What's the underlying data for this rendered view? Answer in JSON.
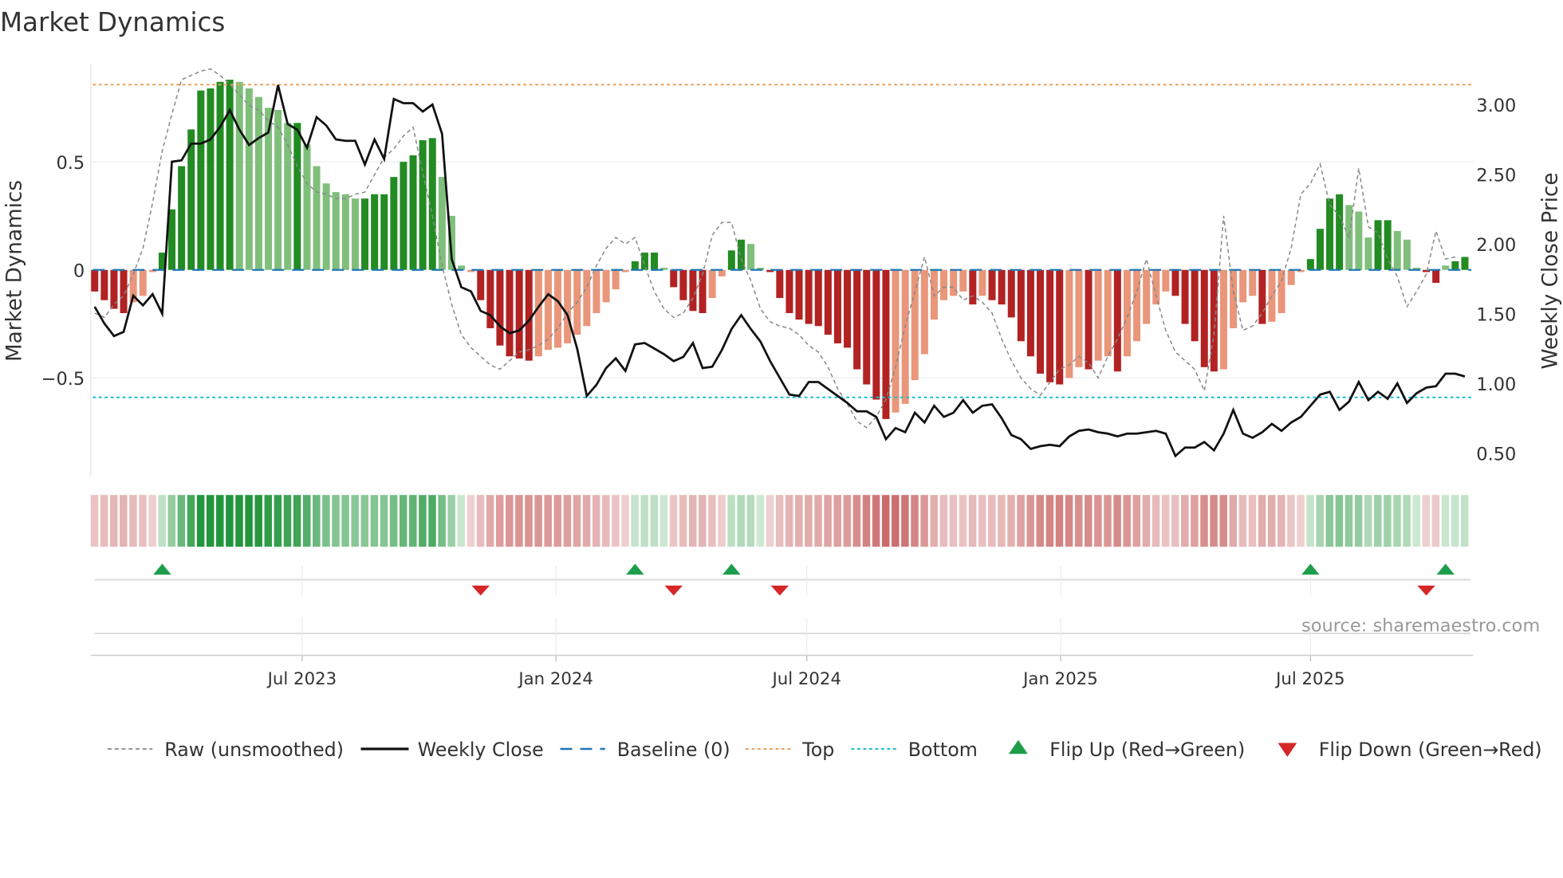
{
  "chart_data": {
    "type": "bar",
    "title": "Market Dynamics",
    "ylabel": "Market Dynamics",
    "y2label": "Weekly Close Price",
    "ylim": [
      -0.97,
      0.97
    ],
    "y2lim": [
      0.32,
      3.3
    ],
    "yticks": [
      {
        "v": 0.5,
        "label": "0.5"
      },
      {
        "v": 0,
        "label": "0"
      },
      {
        "v": -0.5,
        "label": "−0.5"
      }
    ],
    "y2ticks": [
      {
        "v": 3.0,
        "label": "3.00"
      },
      {
        "v": 2.5,
        "label": "2.50"
      },
      {
        "v": 2.0,
        "label": "2.00"
      },
      {
        "v": 1.5,
        "label": "1.50"
      },
      {
        "v": 1.0,
        "label": "1.00"
      },
      {
        "v": 0.5,
        "label": "0.50"
      }
    ],
    "xticks": [
      {
        "week": 21.5,
        "label": "Jul 2023"
      },
      {
        "week": 47.8,
        "label": "Jan 2024"
      },
      {
        "week": 73.8,
        "label": "Jul 2024"
      },
      {
        "week": 100.1,
        "label": "Jan 2025"
      },
      {
        "week": 126.0,
        "label": "Jul 2025"
      }
    ],
    "top_level": 0.857,
    "bottom_level": -0.59,
    "baseline": 0,
    "series": [
      {
        "name": "Market Dynamics (smoothed)",
        "values": [
          -0.1,
          -0.14,
          -0.18,
          -0.2,
          -0.15,
          -0.12,
          -0.01,
          0.08,
          0.28,
          0.48,
          0.65,
          0.83,
          0.84,
          0.87,
          0.88,
          0.87,
          0.84,
          0.8,
          0.75,
          0.74,
          0.68,
          0.68,
          0.58,
          0.48,
          0.4,
          0.36,
          0.35,
          0.33,
          0.33,
          0.35,
          0.35,
          0.43,
          0.5,
          0.53,
          0.6,
          0.61,
          0.43,
          0.25,
          0.02,
          -0.01,
          -0.14,
          -0.27,
          -0.35,
          -0.4,
          -0.41,
          -0.42,
          -0.4,
          -0.37,
          -0.36,
          -0.34,
          -0.3,
          -0.26,
          -0.2,
          -0.15,
          -0.09,
          -0.01,
          0.04,
          0.08,
          0.08,
          0.01,
          -0.08,
          -0.14,
          -0.19,
          -0.2,
          -0.13,
          -0.03,
          0.09,
          0.14,
          0.12,
          0.01,
          -0.01,
          -0.13,
          -0.2,
          -0.23,
          -0.25,
          -0.26,
          -0.3,
          -0.34,
          -0.36,
          -0.46,
          -0.53,
          -0.6,
          -0.69,
          -0.66,
          -0.62,
          -0.51,
          -0.39,
          -0.23,
          -0.14,
          -0.12,
          -0.1,
          -0.16,
          -0.12,
          -0.14,
          -0.16,
          -0.22,
          -0.33,
          -0.4,
          -0.48,
          -0.52,
          -0.53,
          -0.5,
          -0.45,
          -0.46,
          -0.42,
          -0.4,
          -0.47,
          -0.4,
          -0.33,
          -0.25,
          -0.16,
          -0.1,
          -0.12,
          -0.25,
          -0.33,
          -0.45,
          -0.47,
          -0.46,
          -0.27,
          -0.15,
          -0.12,
          -0.25,
          -0.24,
          -0.2,
          -0.07,
          -0.01,
          0.05,
          0.19,
          0.33,
          0.35,
          0.3,
          0.27,
          0.15,
          0.23,
          0.23,
          0.18,
          0.14,
          0.01,
          -0.01,
          -0.06,
          0.02,
          0.04,
          0.06
        ]
      },
      {
        "name": "Raw (unsmoothed)",
        "values": [
          -0.2,
          -0.22,
          -0.16,
          -0.12,
          -0.02,
          0.1,
          0.31,
          0.55,
          0.72,
          0.88,
          0.9,
          0.92,
          0.93,
          0.9,
          0.86,
          0.81,
          0.76,
          0.74,
          0.69,
          0.66,
          0.58,
          0.48,
          0.4,
          0.36,
          0.35,
          0.33,
          0.33,
          0.35,
          0.36,
          0.44,
          0.52,
          0.56,
          0.62,
          0.66,
          0.45,
          0.25,
          0.02,
          -0.16,
          -0.3,
          -0.36,
          -0.4,
          -0.44,
          -0.46,
          -0.42,
          -0.38,
          -0.37,
          -0.35,
          -0.32,
          -0.27,
          -0.2,
          -0.15,
          -0.08,
          0.02,
          0.1,
          0.15,
          0.12,
          0.15,
          0.02,
          -0.1,
          -0.18,
          -0.22,
          -0.2,
          -0.13,
          -0.02,
          0.16,
          0.22,
          0.22,
          0.05,
          -0.05,
          -0.18,
          -0.24,
          -0.26,
          -0.27,
          -0.3,
          -0.35,
          -0.38,
          -0.45,
          -0.55,
          -0.62,
          -0.7,
          -0.73,
          -0.68,
          -0.6,
          -0.45,
          -0.26,
          -0.1,
          0.06,
          -0.12,
          -0.08,
          -0.08,
          -0.14,
          -0.12,
          -0.15,
          -0.2,
          -0.32,
          -0.42,
          -0.5,
          -0.55,
          -0.58,
          -0.52,
          -0.46,
          -0.44,
          -0.4,
          -0.43,
          -0.5,
          -0.4,
          -0.32,
          -0.22,
          -0.1,
          0.05,
          -0.12,
          -0.28,
          -0.38,
          -0.42,
          -0.46,
          -0.56,
          -0.3,
          0.25,
          -0.1,
          -0.28,
          -0.26,
          -0.2,
          -0.12,
          -0.05,
          0.1,
          0.35,
          0.4,
          0.49,
          0.3,
          0.25,
          0.15,
          0.47,
          0.2,
          0.17,
          0.05,
          -0.03,
          -0.17,
          -0.1,
          -0.02,
          0.18,
          0.05,
          0.06
        ]
      },
      {
        "name": "Weekly Close",
        "axis": "right",
        "values": [
          1.55,
          1.43,
          1.34,
          1.37,
          1.63,
          1.56,
          1.64,
          1.5,
          2.59,
          2.6,
          2.72,
          2.72,
          2.75,
          2.84,
          2.96,
          2.82,
          2.71,
          2.76,
          2.8,
          3.14,
          2.86,
          2.82,
          2.69,
          2.91,
          2.85,
          2.75,
          2.74,
          2.74,
          2.57,
          2.75,
          2.61,
          3.04,
          3.01,
          3.01,
          2.95,
          3.0,
          2.79,
          1.89,
          1.69,
          1.66,
          1.52,
          1.49,
          1.41,
          1.36,
          1.38,
          1.45,
          1.55,
          1.64,
          1.59,
          1.49,
          1.25,
          0.91,
          0.99,
          1.11,
          1.18,
          1.09,
          1.28,
          1.29,
          1.25,
          1.21,
          1.16,
          1.19,
          1.29,
          1.11,
          1.12,
          1.24,
          1.39,
          1.49,
          1.39,
          1.3,
          1.16,
          1.04,
          0.92,
          0.91,
          1.01,
          1.01,
          0.96,
          0.91,
          0.86,
          0.8,
          0.8,
          0.76,
          0.6,
          0.68,
          0.65,
          0.79,
          0.72,
          0.84,
          0.76,
          0.79,
          0.88,
          0.79,
          0.84,
          0.85,
          0.75,
          0.63,
          0.6,
          0.53,
          0.55,
          0.56,
          0.55,
          0.62,
          0.66,
          0.67,
          0.65,
          0.64,
          0.62,
          0.64,
          0.64,
          0.65,
          0.66,
          0.64,
          0.48,
          0.54,
          0.54,
          0.58,
          0.52,
          0.64,
          0.81,
          0.64,
          0.61,
          0.65,
          0.71,
          0.66,
          0.72,
          0.76,
          0.84,
          0.92,
          0.94,
          0.81,
          0.87,
          1.01,
          0.88,
          0.94,
          0.89,
          1.0,
          0.86,
          0.93,
          0.97,
          0.98,
          1.07,
          1.07,
          1.05
        ]
      }
    ],
    "flip_up_weeks": [
      7,
      56,
      66,
      126,
      140
    ],
    "flip_down_weeks": [
      40,
      60,
      71,
      138
    ],
    "legend": {
      "placement": "bottom",
      "items": [
        "Raw (unsmoothed)",
        "Weekly Close",
        "Baseline (0)",
        "Top",
        "Bottom",
        "Flip Up (Red→Green)",
        "Flip Down (Green→Red)"
      ]
    },
    "annotation": "source: sharemaestro.com"
  },
  "colors": {
    "green_dark": "#228b22",
    "green_light": "#7fbf7b",
    "red_dark": "#b22222",
    "red_light": "#e9967a",
    "raw": "#888888",
    "close": "#111111",
    "baseline": "#1f77b4",
    "top": "#e8a15a",
    "bottom": "#17becf",
    "flip_up": "#1e9e4a",
    "flip_down": "#d62728"
  }
}
